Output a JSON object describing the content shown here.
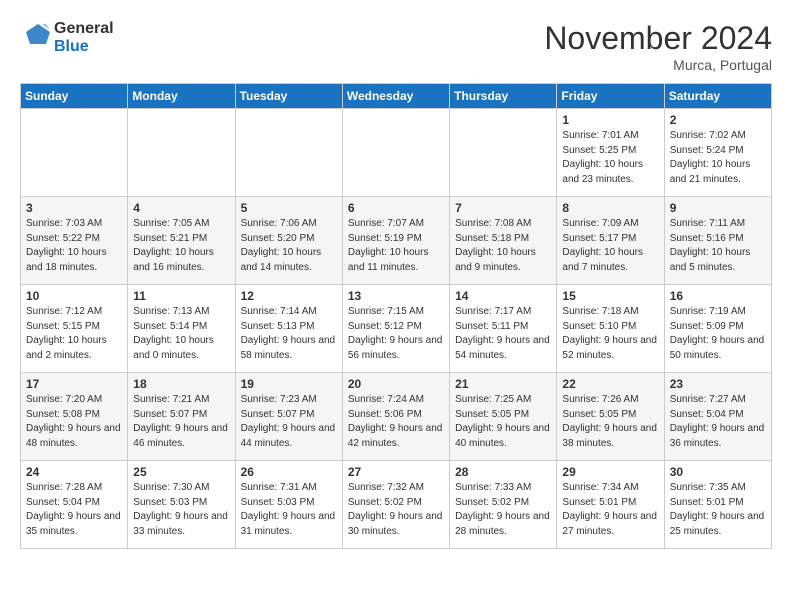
{
  "header": {
    "logo_text_general": "General",
    "logo_text_blue": "Blue",
    "month_title": "November 2024",
    "subtitle": "Murca, Portugal"
  },
  "days_of_week": [
    "Sunday",
    "Monday",
    "Tuesday",
    "Wednesday",
    "Thursday",
    "Friday",
    "Saturday"
  ],
  "weeks": [
    [
      {
        "num": "",
        "info": ""
      },
      {
        "num": "",
        "info": ""
      },
      {
        "num": "",
        "info": ""
      },
      {
        "num": "",
        "info": ""
      },
      {
        "num": "",
        "info": ""
      },
      {
        "num": "1",
        "info": "Sunrise: 7:01 AM\nSunset: 5:25 PM\nDaylight: 10 hours and 23 minutes."
      },
      {
        "num": "2",
        "info": "Sunrise: 7:02 AM\nSunset: 5:24 PM\nDaylight: 10 hours and 21 minutes."
      }
    ],
    [
      {
        "num": "3",
        "info": "Sunrise: 7:03 AM\nSunset: 5:22 PM\nDaylight: 10 hours and 18 minutes."
      },
      {
        "num": "4",
        "info": "Sunrise: 7:05 AM\nSunset: 5:21 PM\nDaylight: 10 hours and 16 minutes."
      },
      {
        "num": "5",
        "info": "Sunrise: 7:06 AM\nSunset: 5:20 PM\nDaylight: 10 hours and 14 minutes."
      },
      {
        "num": "6",
        "info": "Sunrise: 7:07 AM\nSunset: 5:19 PM\nDaylight: 10 hours and 11 minutes."
      },
      {
        "num": "7",
        "info": "Sunrise: 7:08 AM\nSunset: 5:18 PM\nDaylight: 10 hours and 9 minutes."
      },
      {
        "num": "8",
        "info": "Sunrise: 7:09 AM\nSunset: 5:17 PM\nDaylight: 10 hours and 7 minutes."
      },
      {
        "num": "9",
        "info": "Sunrise: 7:11 AM\nSunset: 5:16 PM\nDaylight: 10 hours and 5 minutes."
      }
    ],
    [
      {
        "num": "10",
        "info": "Sunrise: 7:12 AM\nSunset: 5:15 PM\nDaylight: 10 hours and 2 minutes."
      },
      {
        "num": "11",
        "info": "Sunrise: 7:13 AM\nSunset: 5:14 PM\nDaylight: 10 hours and 0 minutes."
      },
      {
        "num": "12",
        "info": "Sunrise: 7:14 AM\nSunset: 5:13 PM\nDaylight: 9 hours and 58 minutes."
      },
      {
        "num": "13",
        "info": "Sunrise: 7:15 AM\nSunset: 5:12 PM\nDaylight: 9 hours and 56 minutes."
      },
      {
        "num": "14",
        "info": "Sunrise: 7:17 AM\nSunset: 5:11 PM\nDaylight: 9 hours and 54 minutes."
      },
      {
        "num": "15",
        "info": "Sunrise: 7:18 AM\nSunset: 5:10 PM\nDaylight: 9 hours and 52 minutes."
      },
      {
        "num": "16",
        "info": "Sunrise: 7:19 AM\nSunset: 5:09 PM\nDaylight: 9 hours and 50 minutes."
      }
    ],
    [
      {
        "num": "17",
        "info": "Sunrise: 7:20 AM\nSunset: 5:08 PM\nDaylight: 9 hours and 48 minutes."
      },
      {
        "num": "18",
        "info": "Sunrise: 7:21 AM\nSunset: 5:07 PM\nDaylight: 9 hours and 46 minutes."
      },
      {
        "num": "19",
        "info": "Sunrise: 7:23 AM\nSunset: 5:07 PM\nDaylight: 9 hours and 44 minutes."
      },
      {
        "num": "20",
        "info": "Sunrise: 7:24 AM\nSunset: 5:06 PM\nDaylight: 9 hours and 42 minutes."
      },
      {
        "num": "21",
        "info": "Sunrise: 7:25 AM\nSunset: 5:05 PM\nDaylight: 9 hours and 40 minutes."
      },
      {
        "num": "22",
        "info": "Sunrise: 7:26 AM\nSunset: 5:05 PM\nDaylight: 9 hours and 38 minutes."
      },
      {
        "num": "23",
        "info": "Sunrise: 7:27 AM\nSunset: 5:04 PM\nDaylight: 9 hours and 36 minutes."
      }
    ],
    [
      {
        "num": "24",
        "info": "Sunrise: 7:28 AM\nSunset: 5:04 PM\nDaylight: 9 hours and 35 minutes."
      },
      {
        "num": "25",
        "info": "Sunrise: 7:30 AM\nSunset: 5:03 PM\nDaylight: 9 hours and 33 minutes."
      },
      {
        "num": "26",
        "info": "Sunrise: 7:31 AM\nSunset: 5:03 PM\nDaylight: 9 hours and 31 minutes."
      },
      {
        "num": "27",
        "info": "Sunrise: 7:32 AM\nSunset: 5:02 PM\nDaylight: 9 hours and 30 minutes."
      },
      {
        "num": "28",
        "info": "Sunrise: 7:33 AM\nSunset: 5:02 PM\nDaylight: 9 hours and 28 minutes."
      },
      {
        "num": "29",
        "info": "Sunrise: 7:34 AM\nSunset: 5:01 PM\nDaylight: 9 hours and 27 minutes."
      },
      {
        "num": "30",
        "info": "Sunrise: 7:35 AM\nSunset: 5:01 PM\nDaylight: 9 hours and 25 minutes."
      }
    ]
  ]
}
